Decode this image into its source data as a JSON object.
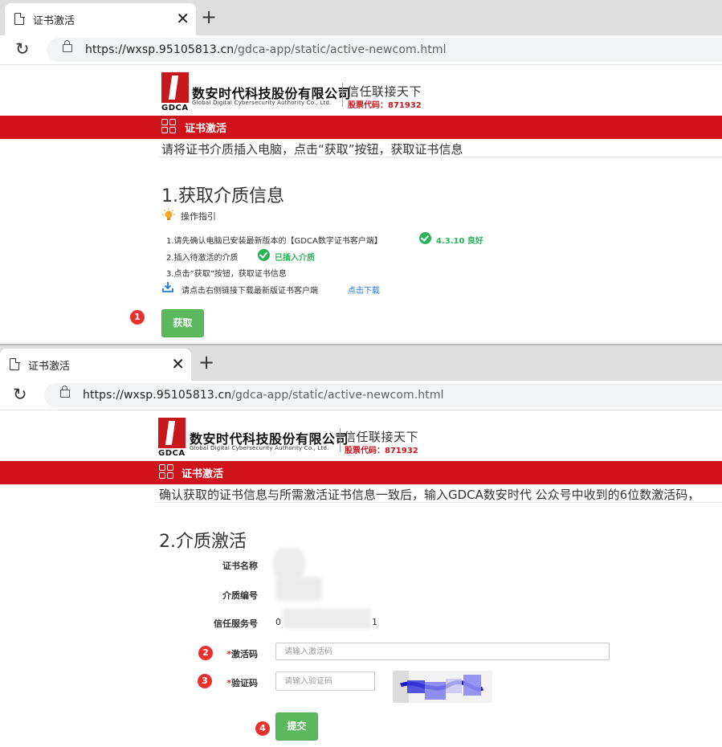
{
  "browser": {
    "tab_title": "证书激活",
    "close_glyph": "✕",
    "new_tab_glyph": "+",
    "reload_glyph": "↻",
    "url_host": "https://wxsp.95105813.cn",
    "url_path": "/gdca-app/static/active-newcom.html"
  },
  "header": {
    "company_name": "数安时代科技股份有限公司",
    "company_name_en": "Global Digital Cybersecurity Authority Co., Ltd.",
    "logo_text": "GDCA",
    "slogan": "信任联接天下",
    "stock_code": "股票代码：871932",
    "section_title": "证书激活"
  },
  "step1": {
    "instruction": "请将证书介质插入电脑，点击“获取”按钮，获取证书信息",
    "heading": "1.获取介质信息",
    "guide_title": "操作指引",
    "lines": {
      "l1": "1.请先确认电脑已安装最新版本的【GDCA数字证书客户端】",
      "l1_status": "4.3.10 良好",
      "l2": "2.插入待激活的介质",
      "l2_status": "已插入介质",
      "l3": "3.点击“获取”按钮，获取证书信息",
      "l4": "请点击右侧链接下载最新版证书客户端",
      "l4_link": "点击下载"
    },
    "marker": "1",
    "get_button": "获取"
  },
  "step2": {
    "instruction": "确认获取的证书信息与所需激活证书信息一致后，输入GDCA数安时代 公众号中收到的6位数激活码，",
    "heading": "2.介质激活",
    "cert_name_label": "证书名称",
    "media_no_label": "介质编号",
    "trust_no_label": "信任服务号",
    "trust_no_prefix": "0",
    "trust_no_suffix": "1",
    "required_mark": "*",
    "activation_label": "激活码",
    "activation_placeholder": "请输入激活码",
    "captcha_label": "验证码",
    "captcha_placeholder": "请输入验证码",
    "markers": [
      "2",
      "3",
      "4"
    ],
    "submit_button": "提交"
  },
  "colors": {
    "brand_red": "#d0121b",
    "success_green": "#27b356",
    "button_green": "#5cb85c",
    "link_blue": "#1f7ae0",
    "marker_red": "#e8302c"
  }
}
